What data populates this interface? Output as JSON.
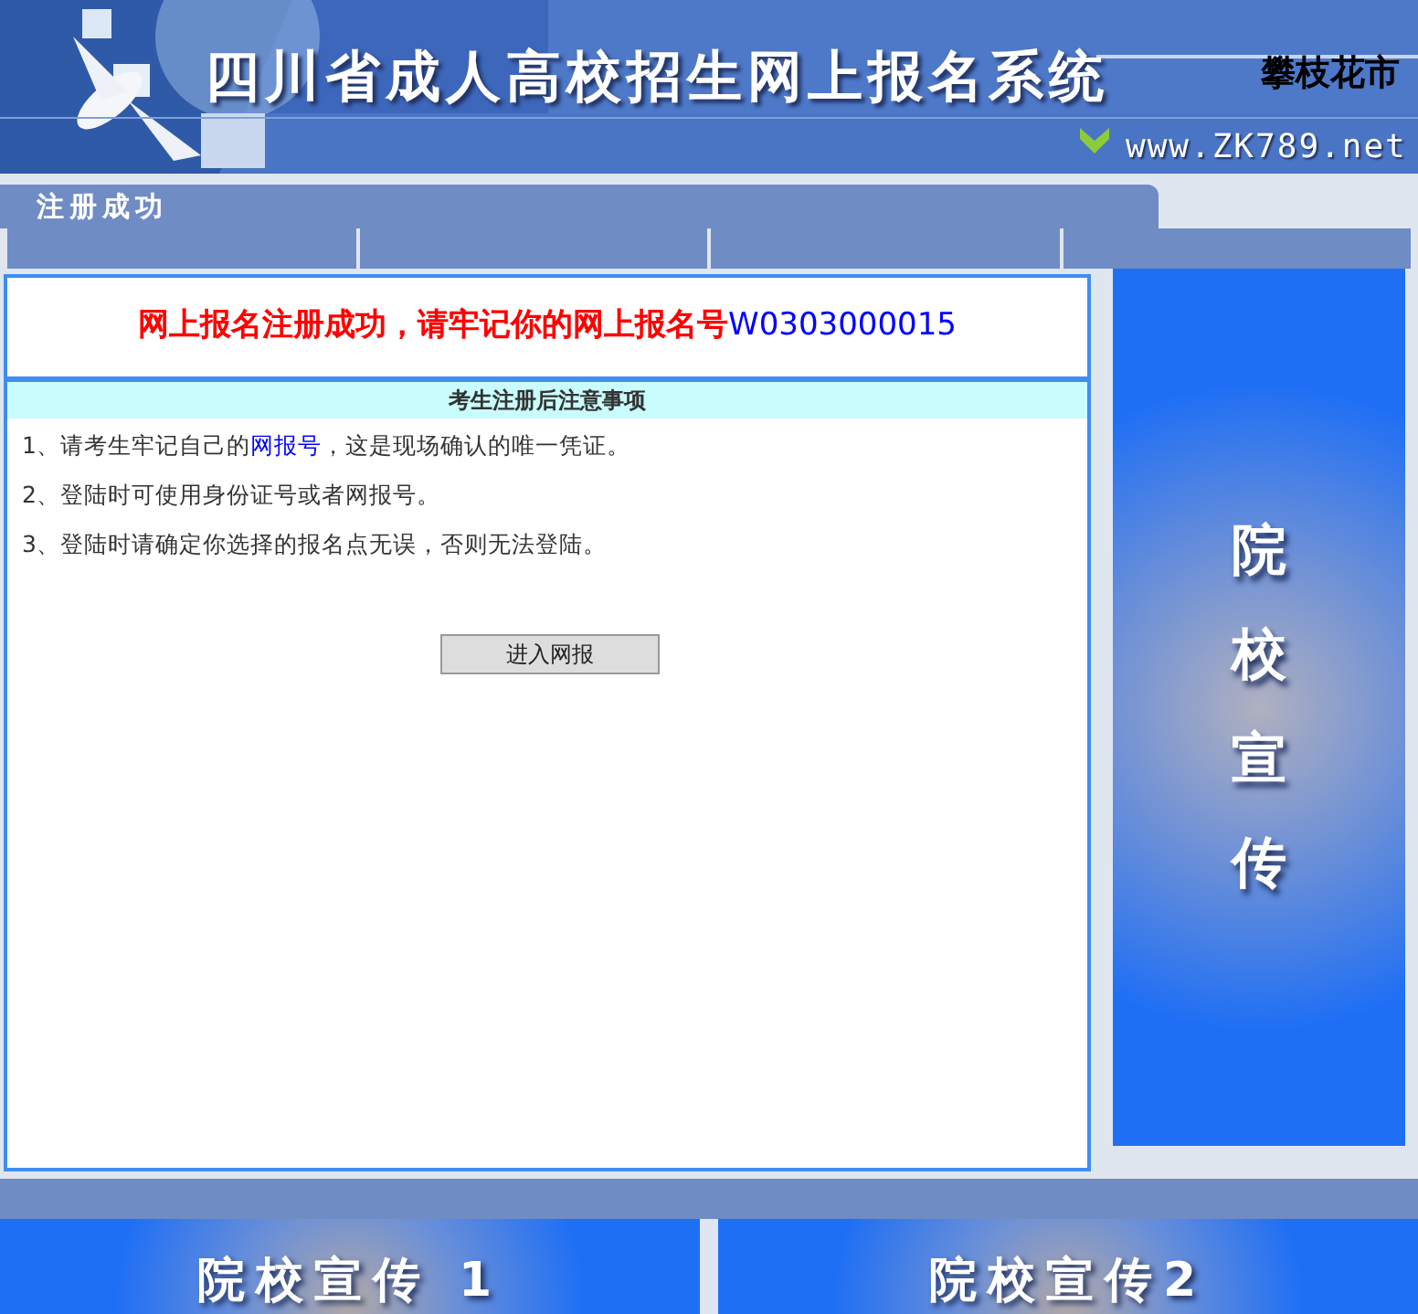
{
  "header": {
    "title": "四川省成人高校招生网上报名系统",
    "city": "攀枝花市",
    "site": "www.ZK789.net"
  },
  "page_title": "注册成功",
  "message": {
    "text": "网上报名注册成功，请牢记你的网上报名号",
    "number": "W0303000015"
  },
  "notice": {
    "heading": "考生注册后注意事项",
    "items": [
      {
        "before": "1、请考生牢记自己的",
        "link": "网报号",
        "after": "，这是现场确认的唯一凭证。"
      },
      {
        "before": "2、登陆时可使用身份证号或者网报号。"
      },
      {
        "before": "3、登陆时请确定你选择的报名点无误，否则无法登陆。"
      }
    ],
    "button": "进入网报"
  },
  "side_banner": "院校宣传",
  "bottom_banners": [
    "院校宣传 1",
    "院校宣传2"
  ]
}
